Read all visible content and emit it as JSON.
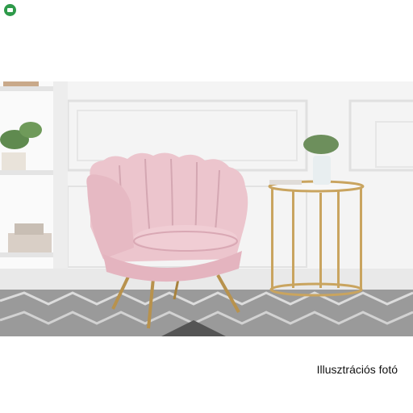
{
  "badge": {
    "icon": "green-logo-icon",
    "color": "#2e9a4a"
  },
  "photo": {
    "subject": "pink-velvet-shell-armchair",
    "colors": {
      "wall": "#f4f4f4",
      "chair": "#ecc5cd",
      "chair_shadow": "#d9a8b4",
      "gold": "#c9a45f",
      "rug": "#8f8f8f"
    }
  },
  "caption": {
    "text": "Illusztrációs fotó"
  }
}
